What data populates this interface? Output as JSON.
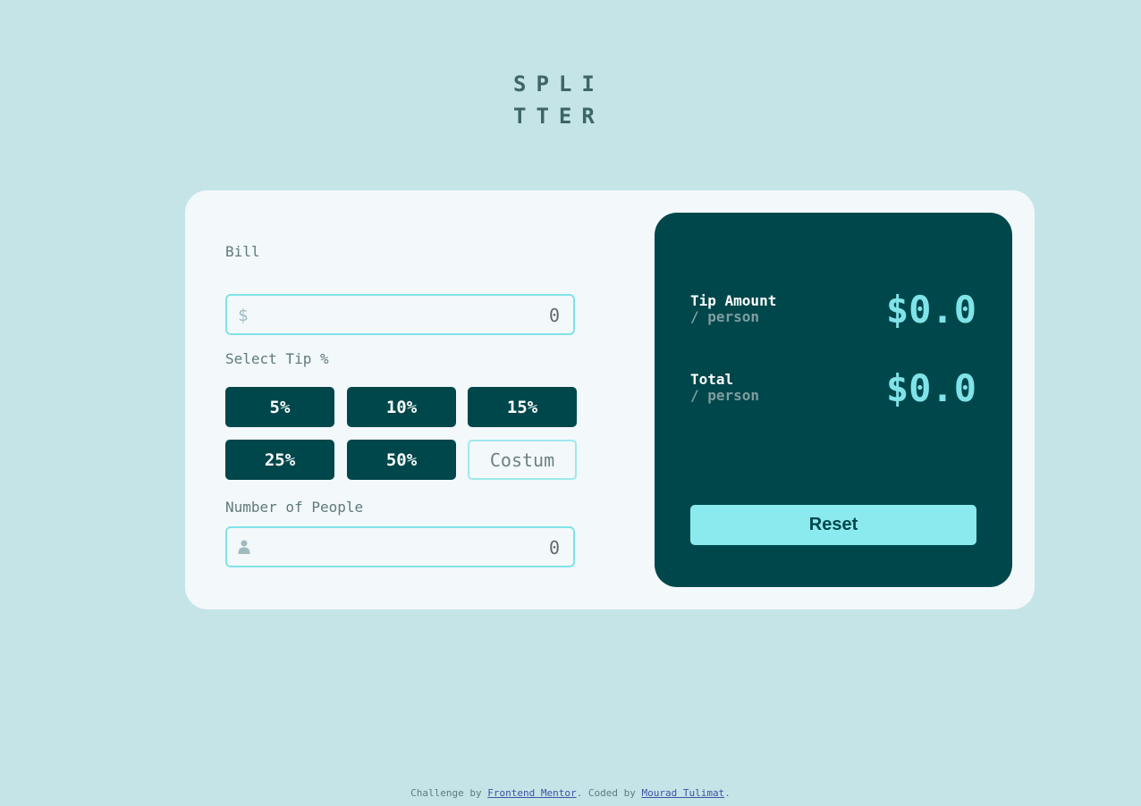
{
  "logo": {
    "line1": "SPLI",
    "line2": "TTER"
  },
  "bill": {
    "label": "Bill",
    "currency_symbol": "$",
    "value": "0"
  },
  "tip": {
    "label": "Select Tip %",
    "options": [
      "5%",
      "10%",
      "15%",
      "25%",
      "50%"
    ],
    "custom_placeholder": "Costum"
  },
  "people": {
    "label": "Number of People",
    "value": "0"
  },
  "results": {
    "tip_amount_label": "Tip Amount",
    "tip_amount_sub": "/ person",
    "tip_amount_value": "$0.0",
    "total_label": "Total",
    "total_sub": "/ person",
    "total_value": "$0.0",
    "reset_label": "Reset"
  },
  "footer": {
    "prefix": "Challenge by ",
    "link1": "Frontend Mentor",
    "middle": ". Coded by ",
    "link2": "Mourad Tulimat",
    "suffix": "."
  },
  "colors": {
    "background": "#c5e4e7",
    "card": "#f3f8fb",
    "dark_cyan": "#00474b",
    "accent": "#7fe3e8"
  },
  "icons": {
    "bill": "dollar-icon",
    "people": "person-icon"
  }
}
